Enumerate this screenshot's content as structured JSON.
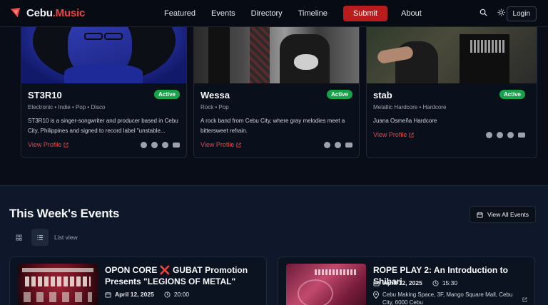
{
  "header": {
    "brand_main": "Cebu",
    "brand_accent": ".Music",
    "nav": [
      "Featured",
      "Events",
      "Directory",
      "Timeline"
    ],
    "submit_label": "Submit",
    "about_label": "About",
    "login_label": "Login"
  },
  "artists": [
    {
      "name": "ST3R10",
      "badge": "Active",
      "genres": "Electronic • Indie • Pop • Disco",
      "description": "ST3R10 is a singer-songwriter and producer based in Cebu City, Philippines and signed to record label \"unstable...",
      "link": "View Profile"
    },
    {
      "name": "Wessa",
      "badge": "Active",
      "genres": "Rock • Pop",
      "description": "A rock band from Cebu City, where gray melodies meet a bittersweet refrain.",
      "link": "View Profile"
    },
    {
      "name": "stab",
      "badge": "Active",
      "genres": "Metallic Hardcore • Hardcore",
      "description": "Juana Osmeña Hardcore",
      "link": "View Profile"
    }
  ],
  "events": {
    "title": "This Week's Events",
    "view_all": "View All Events",
    "view_label": "List view",
    "items": [
      {
        "title_a": "OPON CORE ",
        "title_x": "❌",
        "title_b": " GUBAT Promotion Presents \"LEGIONS OF METAL\"",
        "date": "April 12, 2025",
        "time": "20:00"
      },
      {
        "title": "ROPE PLAY 2: An Introduction to Shibari",
        "date": "April 12, 2025",
        "time": "15:30",
        "location": "Cebu Making Space, 3F, Mango Square Mall, Cebu City, 6000 Cebu"
      }
    ]
  },
  "colors": {
    "accent": "#ef4444",
    "submit_bg": "#b91c1c",
    "badge": "#16a34a",
    "bg": "#0b1120"
  }
}
